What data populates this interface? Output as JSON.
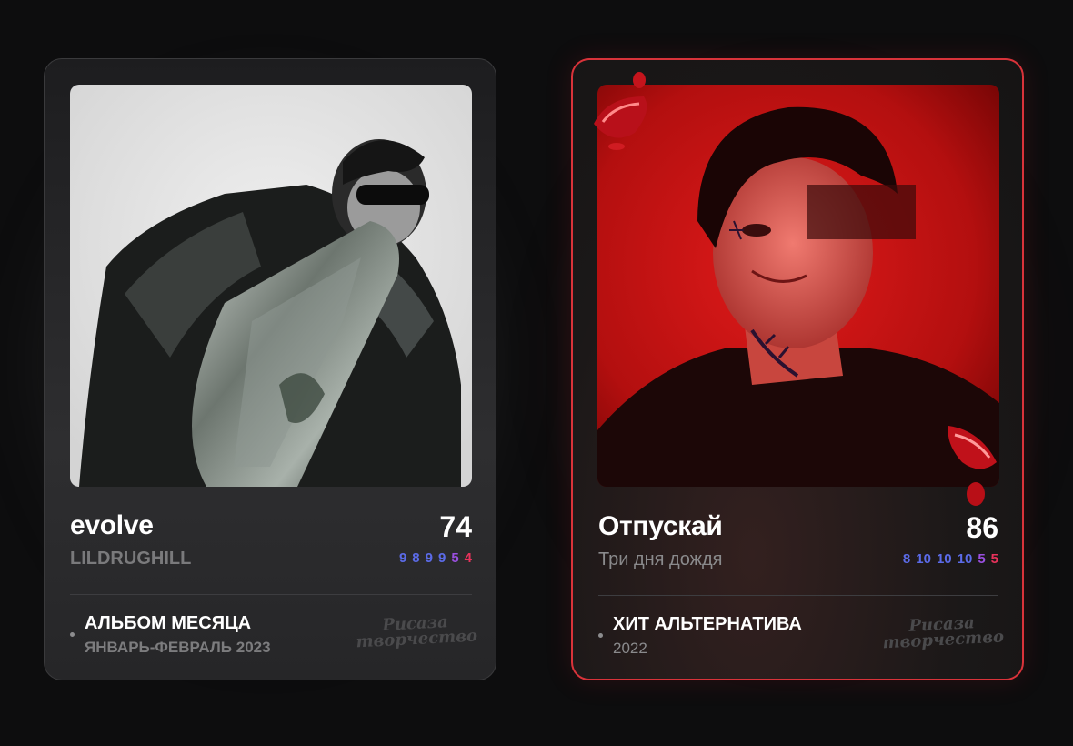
{
  "cards": [
    {
      "title": "evolve",
      "artist": "LILDRUGHILL",
      "score": "74",
      "sub_scores": [
        {
          "value": "9",
          "color": "#5b6be8"
        },
        {
          "value": "8",
          "color": "#5b6be8"
        },
        {
          "value": "9",
          "color": "#5b6be8"
        },
        {
          "value": "9",
          "color": "#5b6be8"
        },
        {
          "value": "5",
          "color": "#9a4fe0"
        },
        {
          "value": "4",
          "color": "#e8325b"
        }
      ],
      "badge_title": "АЛЬБОМ МЕСЯЦА",
      "badge_sub": "ЯНВАРЬ-ФЕВРАЛЬ 2023",
      "watermark_line1": "Рисаза",
      "watermark_line2": "творчество",
      "cover_icon": "album-cover-bw-portrait",
      "accent": "#3a3a3c"
    },
    {
      "title": "Отпускай",
      "artist": "Три дня дождя",
      "score": "86",
      "sub_scores": [
        {
          "value": "8",
          "color": "#5b6be8"
        },
        {
          "value": "10",
          "color": "#5b6be8"
        },
        {
          "value": "10",
          "color": "#5b6be8"
        },
        {
          "value": "10",
          "color": "#5b6be8"
        },
        {
          "value": "5",
          "color": "#9a4fe0"
        },
        {
          "value": "5",
          "color": "#e8325b"
        }
      ],
      "badge_title": "ХИТ АЛЬТЕРНАТИВА",
      "badge_sub": "2022",
      "watermark_line1": "Рисаза",
      "watermark_line2": "творчество",
      "cover_icon": "album-cover-red-portrait",
      "accent": "#d9333a"
    }
  ]
}
